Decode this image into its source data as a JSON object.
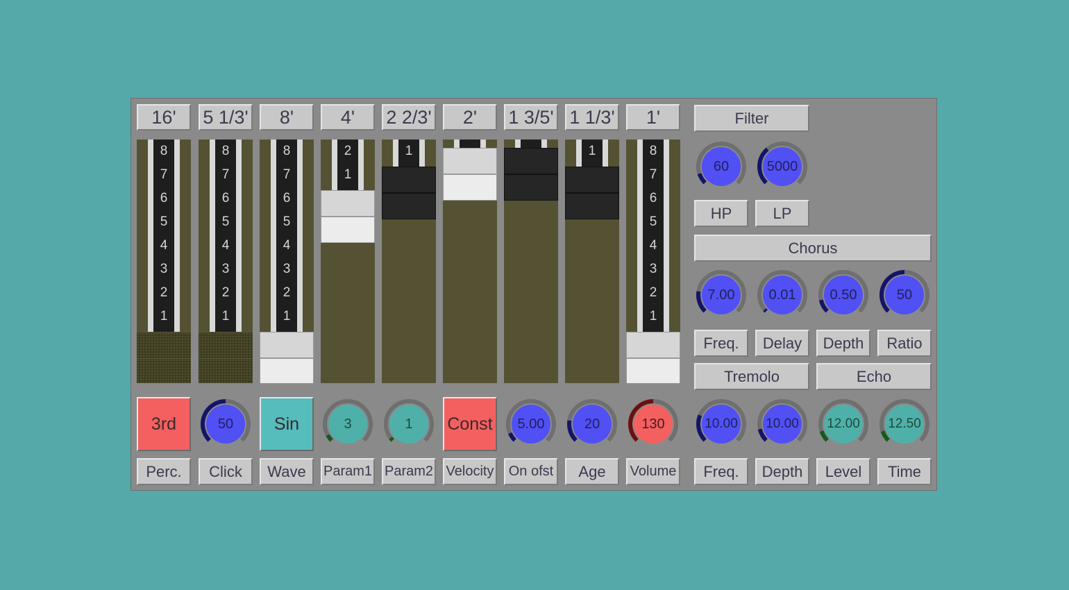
{
  "colors": {
    "background": "#56a9a9",
    "panel": "#8a8a8a",
    "knob_blue": "#5050f5",
    "knob_teal": "#4fb0aa",
    "knob_red": "#f46060",
    "button_red": "#f46060",
    "button_teal": "#56bcbc",
    "track": "#555234"
  },
  "drawbars": {
    "headers": [
      "16'",
      "5 1/3'",
      "8'",
      "4'",
      "2 2/3'",
      "2'",
      "1 3/5'",
      "1 1/3'",
      "1'"
    ],
    "tick_numbers": [
      "8",
      "7",
      "6",
      "5",
      "4",
      "3",
      "2",
      "1"
    ],
    "levels": [
      8,
      8,
      8,
      2,
      1,
      0,
      0,
      1,
      8
    ]
  },
  "bottom_controls": [
    {
      "type": "button",
      "value": "3rd",
      "label": "Perc.",
      "color": "#f46060"
    },
    {
      "type": "knob",
      "value": "50",
      "label": "Click",
      "color": "#5050f5",
      "fraction": 0.5
    },
    {
      "type": "button",
      "value": "Sin",
      "label": "Wave",
      "color": "#56bcbc"
    },
    {
      "type": "knob",
      "value": "3",
      "label": "Param1",
      "color": "#4fb0aa",
      "fraction": 0.06
    },
    {
      "type": "knob",
      "value": "1",
      "label": "Param2",
      "color": "#4fb0aa",
      "fraction": 0.03
    },
    {
      "type": "button",
      "value": "Const",
      "label": "Velocity",
      "color": "#f46060"
    },
    {
      "type": "knob",
      "value": "5.00",
      "label": "On ofst",
      "color": "#5050f5",
      "fraction": 0.08
    },
    {
      "type": "knob",
      "value": "20",
      "label": "Age",
      "color": "#5050f5",
      "fraction": 0.2
    },
    {
      "type": "knob",
      "value": "130",
      "label": "Volume",
      "color": "#f46060",
      "fraction": 0.5
    }
  ],
  "filter": {
    "title": "Filter",
    "knobs": [
      {
        "value": "60",
        "color": "#5050f5",
        "fraction": 0.1
      },
      {
        "value": "5000",
        "color": "#5050f5",
        "fraction": 0.35
      }
    ],
    "labels": [
      "HP",
      "LP"
    ]
  },
  "chorus": {
    "title": "Chorus",
    "knobs": [
      {
        "value": "7.00",
        "color": "#5050f5",
        "fraction": 0.2
      },
      {
        "value": "0.01",
        "color": "#5050f5",
        "fraction": 0.02
      },
      {
        "value": "0.50",
        "color": "#5050f5",
        "fraction": 0.12
      },
      {
        "value": "50",
        "color": "#5050f5",
        "fraction": 0.5
      }
    ],
    "labels": [
      "Freq.",
      "Delay",
      "Depth",
      "Ratio"
    ]
  },
  "tremolo": {
    "title": "Tremolo"
  },
  "echo": {
    "title": "Echo"
  },
  "fx_knobs": [
    {
      "value": "10.00",
      "label": "Freq.",
      "color": "#5050f5",
      "fraction": 0.25
    },
    {
      "value": "10.00",
      "label": "Depth",
      "color": "#5050f5",
      "fraction": 0.12
    },
    {
      "value": "12.00",
      "label": "Level",
      "color": "#4fb0aa",
      "fraction": 0.1
    },
    {
      "value": "12.50",
      "label": "Time",
      "color": "#4fb0aa",
      "fraction": 0.1
    }
  ]
}
